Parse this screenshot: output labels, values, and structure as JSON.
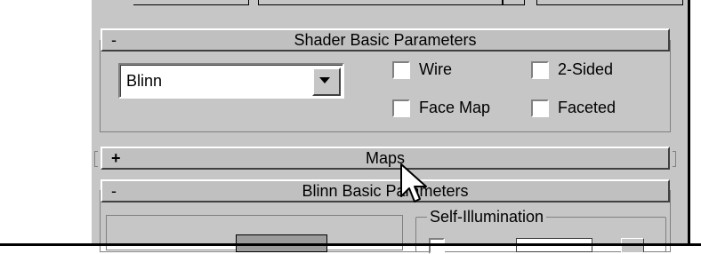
{
  "shader_rollout": {
    "sign": "-",
    "title": "Shader Basic Parameters",
    "shader_dropdown": {
      "value": "Blinn"
    },
    "checkboxes": {
      "wire": "Wire",
      "two_sided": "2-Sided",
      "face_map": "Face Map",
      "faceted": "Faceted"
    }
  },
  "maps_rollout": {
    "sign": "+",
    "title": "Maps"
  },
  "blinn_rollout": {
    "sign": "-",
    "title": "Blinn Basic Parameters",
    "self_illumination": {
      "title": "Self-Illumination"
    }
  },
  "colors": {
    "panel_bg": "#c6c6c6",
    "swatch": "#9c9c9c"
  }
}
